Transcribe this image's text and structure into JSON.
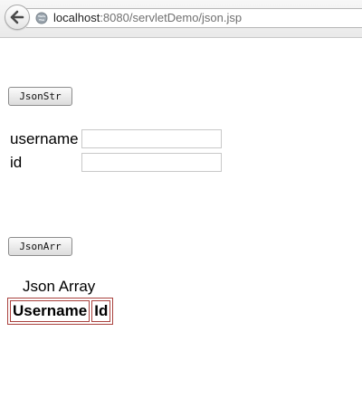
{
  "browser": {
    "url_host": "localhost",
    "url_rest": ":8080/servletDemo/json.jsp"
  },
  "page": {
    "jsonstr_button_label": "JsonStr",
    "username_label": "username",
    "id_label": "id",
    "username_value": "",
    "id_value": "",
    "jsonarr_button_label": "JsonArr",
    "table": {
      "caption": "Json Array",
      "headers": [
        "Username",
        "Id"
      ]
    }
  },
  "colors": {
    "table_border": "#a9413d"
  },
  "icons": {
    "back": "back-arrow-icon",
    "site": "globe-icon"
  }
}
